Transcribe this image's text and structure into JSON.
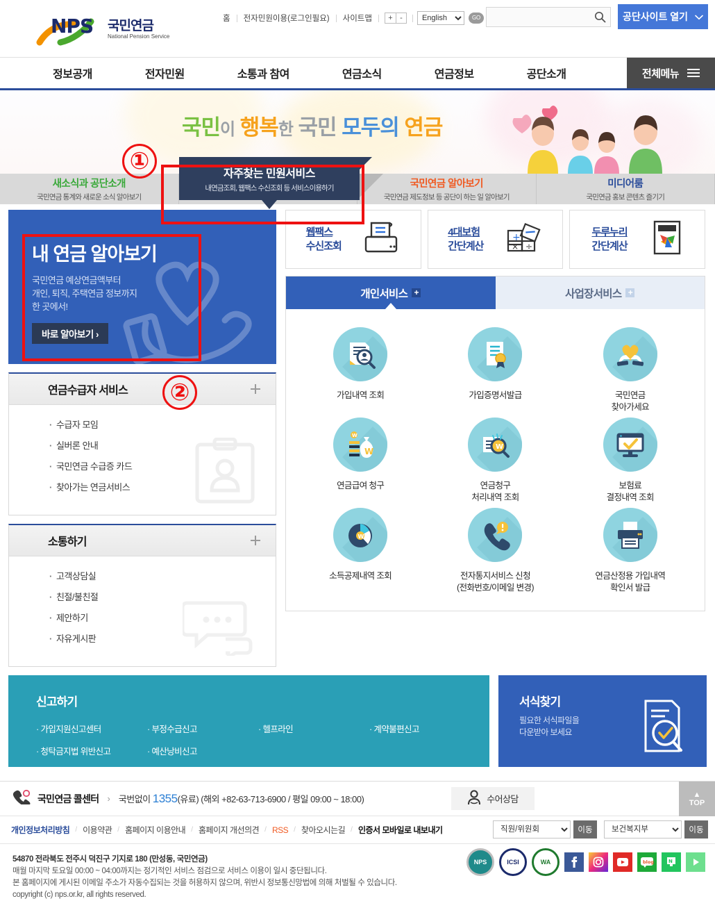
{
  "header": {
    "logo_main": "NPS",
    "logo_ko": "국민연금",
    "logo_en": "National Pension Service",
    "util_links": [
      "홈",
      "전자민원이용(로그인필요)",
      "사이트맵"
    ],
    "font_increase": "+",
    "font_decrease": "-",
    "language_selected": "English",
    "go_label": "GO",
    "search_placeholder": "",
    "search_value": "",
    "open_site_label": "공단사이트 열기"
  },
  "gnb": {
    "items": [
      "정보공개",
      "전자민원",
      "소통과 참여",
      "연금소식",
      "연금정보",
      "공단소개"
    ],
    "all_menu": "전체메뉴"
  },
  "banner": {
    "slogan_parts": [
      {
        "t": "국민",
        "c": "g"
      },
      {
        "t": "이",
        "c": "gr"
      },
      {
        "t": "행복",
        "c": "o"
      },
      {
        "t": "한",
        "c": "gr"
      },
      {
        "t": "국민",
        "c": "gr"
      },
      {
        "t": "모두의",
        "c": "b"
      },
      {
        "t": "연금",
        "c": "o"
      }
    ],
    "slogan_full": "국민이 행복한 국민 모두의 연금"
  },
  "tabstrip": {
    "tabs": [
      {
        "title": "새소식과 공단소개",
        "sub": "국민연금 통계와 새로운 소식 알아보기",
        "active": false
      },
      {
        "title": "자주찾는 민원서비스",
        "sub": "내연금조회, 웹팩스 수신조회 등 서비스이용하기",
        "active": true
      },
      {
        "title": "국민연금 알아보기",
        "sub": "국민연금 제도정보 등 공단이 하는 일 알아보기",
        "active": false
      },
      {
        "title": "미디어룸",
        "sub": "국민연금 홍보 콘텐츠 즐기기",
        "active": false
      }
    ]
  },
  "promo": {
    "title": "내 연금 알아보기",
    "desc": "국민연금 예상연금액부터\n개인, 퇴직, 주택연금 정보까지\n한 곳에서!",
    "cta": "바로 알아보기 ›"
  },
  "panels": [
    {
      "title": "연금수급자 서비스",
      "plus": "+",
      "items": [
        "수급자 모임",
        "실버론 안내",
        "국민연금 수급증 카드",
        "찾아가는 연금서비스"
      ],
      "watermark": "id-card-icon"
    },
    {
      "title": "소통하기",
      "plus": "+",
      "items": [
        "고객상담실",
        "친절/불친절",
        "제안하기",
        "자유게시판"
      ],
      "watermark": "chat-bubble-icon"
    }
  ],
  "quick_cards": [
    {
      "line1": "웹팩스",
      "line2": "수신조회",
      "icon": "fax-printer-icon"
    },
    {
      "line1": "4대보험",
      "line2": "간단계산",
      "icon": "calculator-icon"
    },
    {
      "line1": "두루누리",
      "line2": "간단계산",
      "icon": "durunuri-icon"
    }
  ],
  "service": {
    "tabs": [
      {
        "label": "개인서비스",
        "plus": "+",
        "active": true
      },
      {
        "label": "사업장서비스",
        "plus": "+",
        "active": false
      }
    ],
    "items": [
      {
        "label": "가입내역 조회",
        "icon": "document-search-icon"
      },
      {
        "label": "가입증명서발급",
        "icon": "certificate-icon"
      },
      {
        "label": "국민연금\n찾아가세요",
        "icon": "hands-heart-icon"
      },
      {
        "label": "연금급여 청구",
        "icon": "money-bag-icon"
      },
      {
        "label": "연금청구\n처리내역 조회",
        "icon": "search-won-icon"
      },
      {
        "label": "보험료\n결정내역 조회",
        "icon": "monitor-check-icon"
      },
      {
        "label": "소득공제내역 조회",
        "icon": "pie-chart-won-icon"
      },
      {
        "label": "전자통지서비스 신청\n(전화번호/이메일 변경)",
        "icon": "phone-alert-icon"
      },
      {
        "label": "연금산정용 가입내역\n확인서 발급",
        "icon": "printer-icon"
      }
    ]
  },
  "report_panel": {
    "title": "신고하기",
    "links_row1": [
      "가입지원신고센터",
      "부정수급신고",
      "헬프라인",
      "계약불편신고"
    ],
    "links_row2": [
      "청탁금지법 위반신고",
      "예산낭비신고"
    ]
  },
  "forms_panel": {
    "title": "서식찾기",
    "desc": "필요한 서식파일을\n다운받아 보세요",
    "icon": "document-search-check-icon"
  },
  "footer": {
    "call_title": "국민연금 콜센터",
    "call_arrow": "›",
    "call_info_pre": "국번없이 ",
    "call_number": "1355",
    "call_info_post": "(유료) (해외 +82-63-713-6900 / 평일 09:00 ~ 18:00)",
    "sign_service": "수어상담",
    "top_label": "TOP",
    "links": [
      {
        "text": "개인정보처리방침",
        "style": "privacy"
      },
      {
        "text": "이용약관",
        "style": ""
      },
      {
        "text": "홈페이지 이용안내",
        "style": ""
      },
      {
        "text": "홈페이지 개선의견",
        "style": ""
      },
      {
        "text": "RSS",
        "style": "rss"
      },
      {
        "text": "찾아오시는길",
        "style": ""
      },
      {
        "text": "인증서 모바일로 내보내기",
        "style": "cert"
      }
    ],
    "select1_value": "직원/위원회",
    "select1_go": "이동",
    "select2_value": "보건복지부",
    "select2_go": "이동",
    "address_lines": [
      "54870 전라북도 전주시 덕진구 기지로 180 (만성동, 국민연금)",
      "매월 마지막 토요일 00:00 ~ 04:00까지는 정기적인 서비스 점검으로 서비스 이용이 일시 중단됩니다.",
      "본 홈페이지에 게시된 이메일 주소가 자동수집되는 것을 허용하지 않으며, 위반시 정보통신망법에 의해 처벌될 수 있습니다.",
      "copyright (c) nps.or.kr, all rights reserved."
    ],
    "badges": [
      "NPS",
      "ICSI",
      "WA"
    ],
    "sns": [
      "facebook-icon",
      "instagram-icon",
      "youtube-icon",
      "blog-icon",
      "naver-post-icon",
      "naver-tv-icon"
    ]
  },
  "annotations": [
    {
      "num": "①",
      "target": "자주찾는 민원서비스 탭"
    },
    {
      "num": "②",
      "target": "내 연금 알아보기 배너"
    }
  ],
  "colors": {
    "brand_blue": "#2b4d9b",
    "promo_blue": "#3260b8",
    "teal": "#2a9fb6",
    "icon_cyan": "#8fd4e0",
    "accent_orange": "#f05a22",
    "annotation_red": "#ee1111"
  }
}
